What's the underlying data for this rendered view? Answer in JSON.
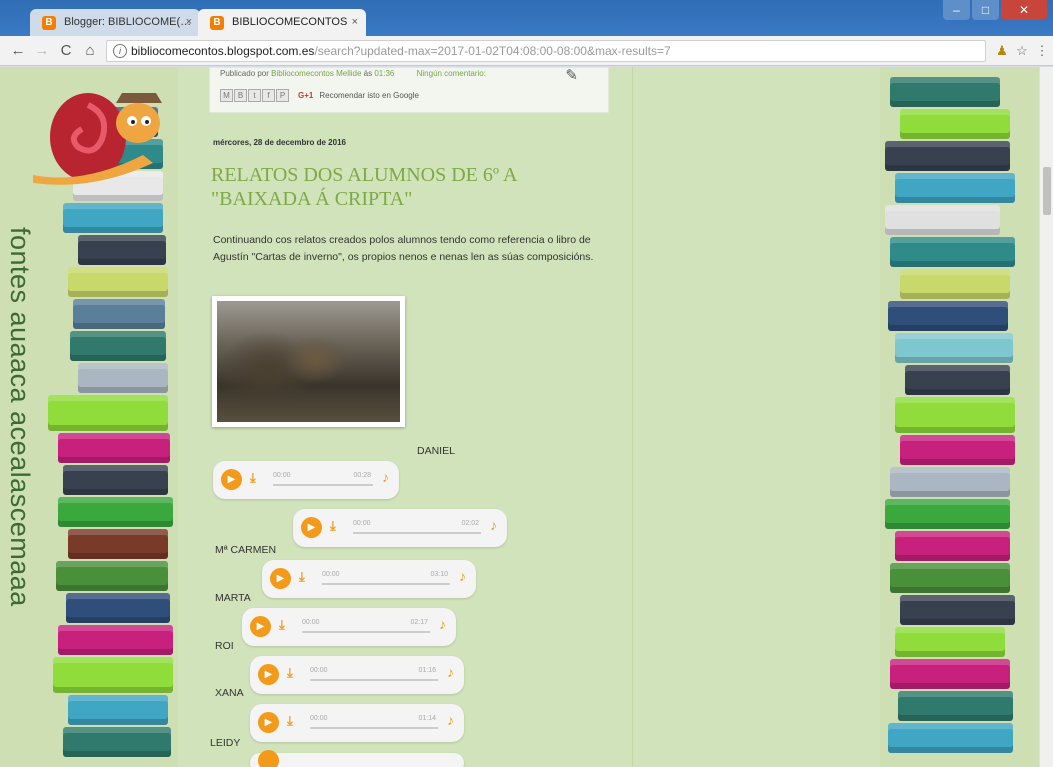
{
  "browser": {
    "tabs": [
      {
        "label": "Blogger: BIBLIOCOME(…",
        "favicon": "B"
      },
      {
        "label": "BIBLIOCOMECONTOS",
        "favicon": "B"
      }
    ],
    "close_glyph": "×",
    "url_host": "bibliocomecontos.blogspot.com.es",
    "url_rest": "/search?updated-max=2017-01-02T04:08:00-08:00&max-results=7",
    "info_glyph": "i",
    "nav": {
      "back": "←",
      "forward": "→",
      "reload": "C",
      "home": "⌂"
    },
    "ext_icon": "♟",
    "star_icon": "☆",
    "menu_icon": "⋮",
    "window": {
      "minimize": "–",
      "maximize": "□",
      "close": "✕"
    }
  },
  "sidebar_vertical_text": "fontes auaaca acealascemaaa",
  "footer_prev_post": {
    "published_prefix": "Publicado por",
    "author": "Bibliocomecontos Mellide",
    "at": "ás",
    "time": "01:36",
    "comments": "Ningún comentario:",
    "share_buttons": [
      "M",
      "B",
      "t",
      "f",
      "P"
    ],
    "gplus": "G+1",
    "recommend": "Recomendar isto en Google",
    "edit_icon": "✎"
  },
  "post": {
    "date": "mércores, 28 de decembro de 2016",
    "title": "RELATOS DOS ALUMNOS DE 6º A \"BAIXADA Á CRIPTA\"",
    "body": "Continuando cos relatos creados polos alumnos tendo como referencia o libro de Agustín \"Cartas de inverno\", os propios nenos e nenas len as súas composicións.",
    "centered_name": "DANIEL",
    "players": [
      {
        "label": "",
        "current": "00:00",
        "duration": "00:28"
      },
      {
        "label": "Mª CARMEN",
        "current": "00:00",
        "duration": "02:02"
      },
      {
        "label": "MARTA",
        "current": "00:00",
        "duration": "03:10"
      },
      {
        "label": "ROI",
        "current": "00:00",
        "duration": "02:17"
      },
      {
        "label": "XANA",
        "current": "00:00",
        "duration": "01:16"
      },
      {
        "label": "LEIDY",
        "current": "00:00",
        "duration": "01:14"
      }
    ],
    "player_icons": {
      "play": "▶",
      "download": "⤓",
      "volume": "♪"
    }
  },
  "colors": {
    "background": "#cfdfb4",
    "title_green": "#7fa947",
    "player_orange": "#f39a1b",
    "tab_bar_blue": "#2f6db5"
  }
}
